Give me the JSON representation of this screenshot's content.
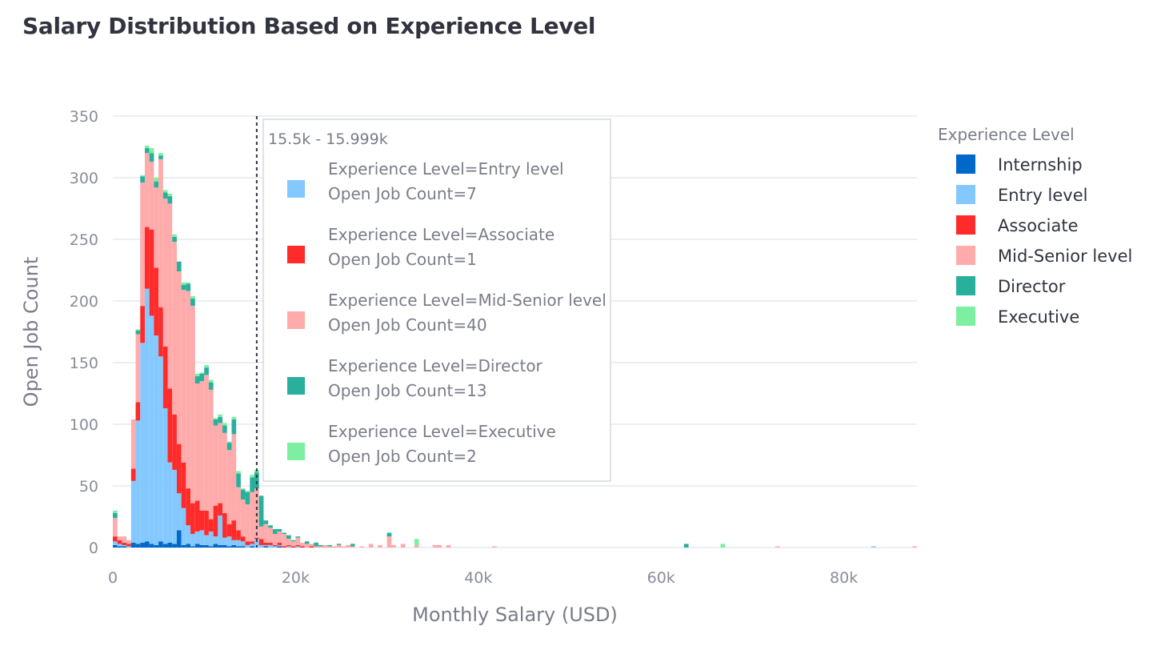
{
  "page_title": "Salary Distribution Based on Experience Level",
  "chart_data": {
    "type": "bar",
    "subtype": "stacked-histogram",
    "xlabel": "Monthly Salary (USD)",
    "ylabel": "Open Job Count",
    "xlim": [
      0,
      88000
    ],
    "ylim": [
      0,
      350
    ],
    "x_ticks": [
      0,
      20000,
      40000,
      60000,
      80000
    ],
    "x_tick_labels": [
      "0",
      "20k",
      "40k",
      "60k",
      "80k"
    ],
    "y_ticks": [
      0,
      50,
      100,
      150,
      200,
      250,
      300,
      350
    ],
    "y_tick_labels": [
      "0",
      "50",
      "100",
      "150",
      "200",
      "250",
      "300",
      "350"
    ],
    "grid": "horizontal",
    "bin_width": 500,
    "bin_starts": [
      0,
      500,
      1000,
      1500,
      2000,
      2500,
      3000,
      3500,
      4000,
      4500,
      5000,
      5500,
      6000,
      6500,
      7000,
      7500,
      8000,
      8500,
      9000,
      9500,
      10000,
      10500,
      11000,
      11500,
      12000,
      12500,
      13000,
      13500,
      14000,
      14500,
      15000,
      15500,
      16000,
      16500,
      17000,
      17500,
      18000,
      18500,
      19000,
      19500,
      20000,
      20500,
      21000,
      21500,
      22000,
      22500,
      23000,
      23500,
      24000,
      24500,
      25000,
      25500,
      26000,
      27000,
      28000,
      29000,
      30000,
      30500,
      31500,
      33000,
      35000,
      35500,
      36500,
      41500,
      62500,
      66500,
      72500,
      83000,
      87500
    ],
    "legend": {
      "title": "Experience Level",
      "position": "right"
    },
    "series": [
      {
        "name": "Internship",
        "color": "#0068c9",
        "values": [
          2,
          1,
          1,
          0,
          4,
          3,
          4,
          5,
          3,
          2,
          5,
          3,
          4,
          3,
          14,
          2,
          3,
          1,
          3,
          2,
          2,
          1,
          3,
          2,
          2,
          1,
          2,
          1,
          1,
          0,
          1,
          0,
          0,
          1,
          0,
          0,
          1,
          0,
          0,
          0,
          0,
          0,
          0,
          0,
          0,
          0,
          0,
          0,
          0,
          0,
          0,
          0,
          0,
          0,
          0,
          0,
          0,
          0,
          0,
          0,
          0,
          0,
          0,
          0,
          0,
          0,
          0,
          0,
          0
        ]
      },
      {
        "name": "Entry level",
        "color": "#83c9ff",
        "values": [
          3,
          2,
          1,
          1,
          50,
          100,
          162,
          205,
          185,
          170,
          150,
          110,
          65,
          60,
          30,
          30,
          15,
          10,
          10,
          12,
          8,
          12,
          6,
          24,
          6,
          8,
          4,
          5,
          4,
          2,
          2,
          7,
          2,
          1,
          2,
          1,
          1,
          0,
          1,
          0,
          1,
          0,
          0,
          0,
          0,
          0,
          0,
          0,
          0,
          0,
          0,
          0,
          0,
          0,
          0,
          0,
          0,
          0,
          0,
          0,
          0,
          0,
          0,
          0,
          0,
          0,
          0,
          1,
          0
        ]
      },
      {
        "name": "Associate",
        "color": "#ff2b2b",
        "values": [
          4,
          3,
          2,
          2,
          10,
          15,
          30,
          50,
          70,
          55,
          40,
          50,
          60,
          45,
          40,
          37,
          30,
          25,
          25,
          16,
          20,
          10,
          25,
          10,
          20,
          10,
          16,
          8,
          4,
          3,
          2,
          1,
          5,
          2,
          2,
          1,
          2,
          1,
          1,
          1,
          1,
          1,
          0,
          1,
          0,
          0,
          0,
          0,
          0,
          0,
          0,
          0,
          0,
          0,
          0,
          0,
          0,
          0,
          0,
          0,
          0,
          0,
          0,
          0,
          0,
          0,
          0,
          0,
          0
        ]
      },
      {
        "name": "Mid-Senior level",
        "color": "#ffabab",
        "values": [
          15,
          3,
          5,
          3,
          40,
          55,
          100,
          60,
          55,
          65,
          120,
          120,
          150,
          140,
          140,
          140,
          160,
          160,
          95,
          105,
          110,
          105,
          65,
          65,
          65,
          60,
          70,
          35,
          30,
          30,
          40,
          40,
          10,
          15,
          12,
          9,
          9,
          10,
          5,
          4,
          6,
          3,
          3,
          2,
          1,
          1,
          2,
          1,
          1,
          2,
          1,
          2,
          1,
          1,
          3,
          2,
          9,
          2,
          3,
          2,
          2,
          2,
          2,
          1,
          0,
          0,
          1,
          0,
          1
        ]
      },
      {
        "name": "Director",
        "color": "#29b09d",
        "values": [
          4,
          0,
          0,
          0,
          0,
          3,
          5,
          4,
          7,
          5,
          3,
          5,
          6,
          4,
          8,
          4,
          6,
          6,
          6,
          6,
          6,
          6,
          5,
          5,
          6,
          6,
          12,
          11,
          8,
          10,
          12,
          13,
          25,
          3,
          2,
          4,
          2,
          1,
          3,
          1,
          1,
          0,
          2,
          0,
          3,
          1,
          0,
          1,
          0,
          1,
          0,
          0,
          2,
          0,
          0,
          0,
          3,
          0,
          0,
          0,
          0,
          0,
          0,
          0,
          3,
          0,
          0,
          0,
          0
        ]
      },
      {
        "name": "Executive",
        "color": "#7defa1",
        "values": [
          2,
          0,
          0,
          0,
          0,
          1,
          1,
          2,
          4,
          3,
          2,
          2,
          2,
          2,
          0,
          2,
          1,
          2,
          2,
          1,
          2,
          2,
          1,
          2,
          2,
          1,
          2,
          2,
          1,
          1,
          2,
          2,
          0,
          0,
          0,
          0,
          0,
          0,
          0,
          0,
          0,
          0,
          0,
          0,
          0,
          0,
          0,
          0,
          0,
          0,
          0,
          0,
          0,
          0,
          0,
          0,
          0,
          0,
          0,
          5,
          0,
          0,
          0,
          0,
          0,
          3,
          0,
          0,
          0
        ]
      }
    ],
    "hover": {
      "position_value": 15750,
      "header": "15.5k - 15.999k",
      "entries": [
        {
          "swatch": "#83c9ff",
          "line1": "Experience Level=Entry level",
          "line2": "Open Job Count=7"
        },
        {
          "swatch": "#ff2b2b",
          "line1": "Experience Level=Associate",
          "line2": "Open Job Count=1"
        },
        {
          "swatch": "#ffabab",
          "line1": "Experience Level=Mid-Senior level",
          "line2": "Open Job Count=40"
        },
        {
          "swatch": "#29b09d",
          "line1": "Experience Level=Director",
          "line2": "Open Job Count=13"
        },
        {
          "swatch": "#7defa1",
          "line1": "Experience Level=Executive",
          "line2": "Open Job Count=2"
        }
      ]
    }
  }
}
